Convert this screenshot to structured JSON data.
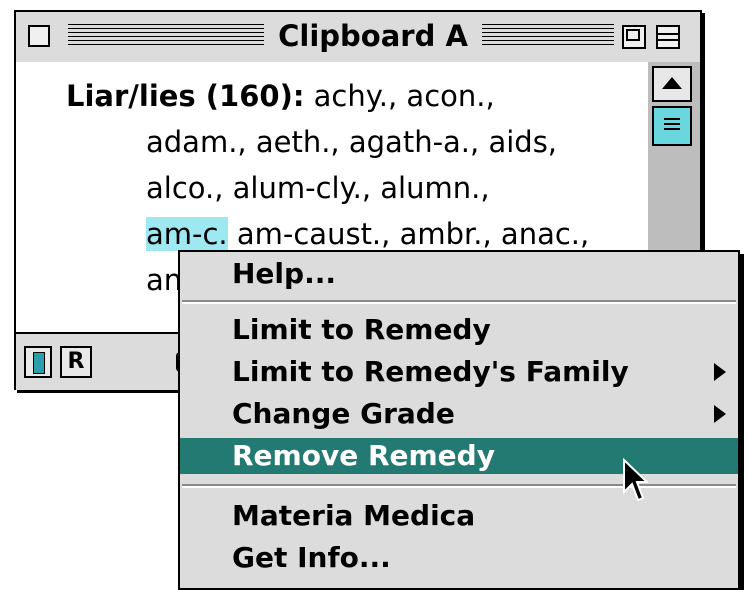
{
  "window": {
    "title": "Clipboard A",
    "content": {
      "line1": {
        "heading": "Liar/lies (160):",
        "rest": " achy., acon.,"
      },
      "line2": "adam., aeth., agath-a., aids,",
      "line3": "alco., alum-cly., alumn.,",
      "line4": {
        "highlighted": "am-c.",
        "rest": " am-caust., ambr., anac.,"
      },
      "line5": "an"
    },
    "bottom_bar": {
      "r_button_label": "R"
    }
  },
  "context_menu": {
    "items": [
      {
        "label": "Help..."
      },
      {
        "label": "Limit to Remedy"
      },
      {
        "label": "Limit to Remedy's Family"
      },
      {
        "label": "Change Grade"
      },
      {
        "label": "Remove Remedy"
      },
      {
        "label": "Materia Medica"
      },
      {
        "label": "Get Info..."
      }
    ],
    "selected_index": 4
  },
  "colors": {
    "highlight": "#9ee8f2",
    "menu_selected": "#237a72",
    "scroll_thumb": "#6ad6dd"
  }
}
